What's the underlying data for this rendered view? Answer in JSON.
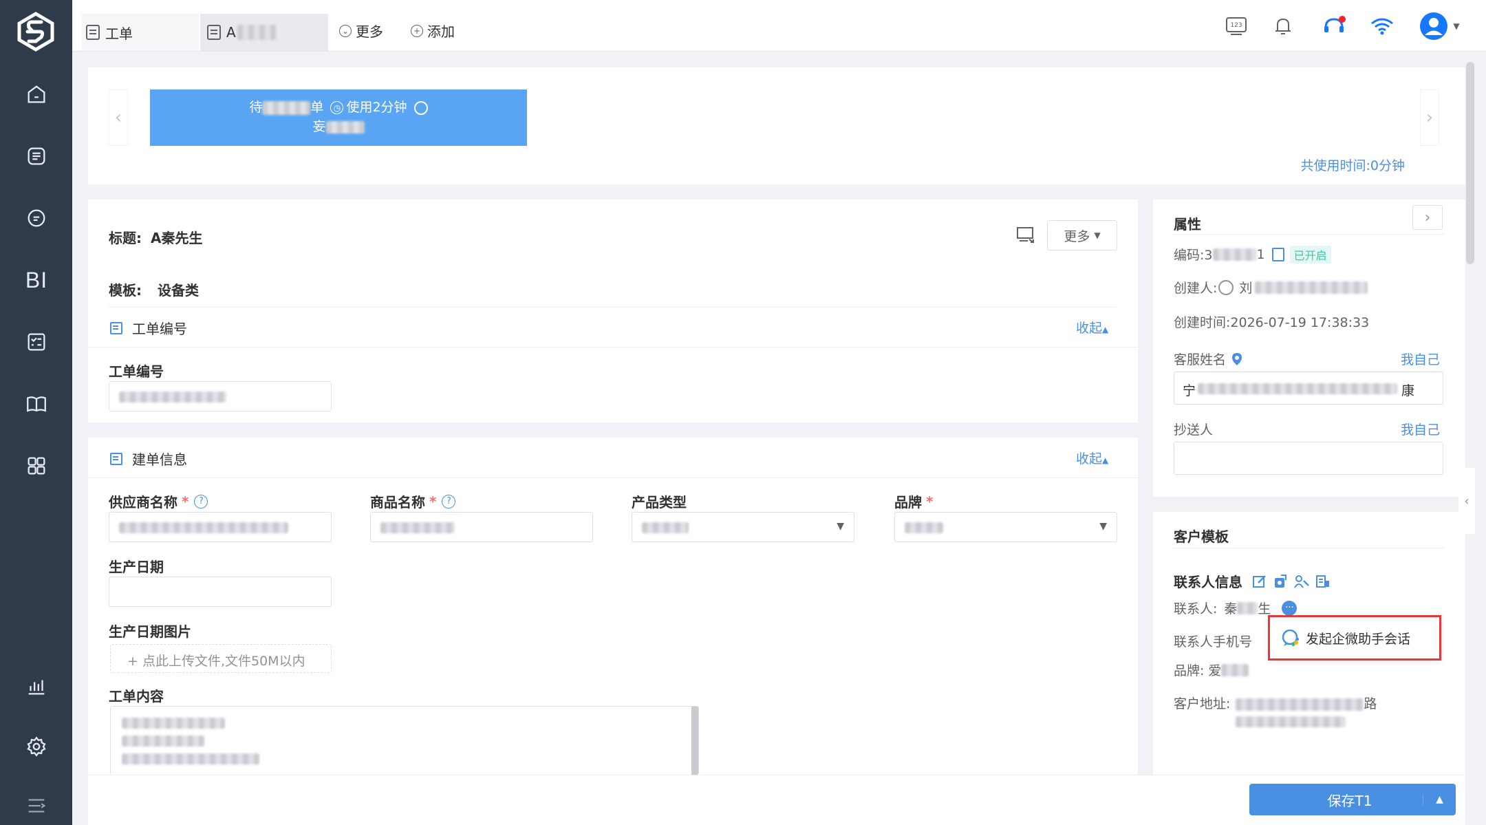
{
  "tabs": {
    "workorder": "工单",
    "second_prefix": "A",
    "more": "更多",
    "add": "添加"
  },
  "timer_card": {
    "prefix": "待",
    "mid": "单",
    "usage": "使用2分钟",
    "line2_prefix": "妄"
  },
  "total_time": "共使用时间:0分钟",
  "header": {
    "title_label": "标题:",
    "title_value": "A秦先生",
    "template_label": "模板:",
    "template_value": "设备类",
    "more_button": "更多"
  },
  "section_number": {
    "title": "工单编号",
    "collapse": "收起",
    "field_label": "工单编号"
  },
  "section_build": {
    "title": "建单信息",
    "collapse": "收起",
    "supplier_label": "供应商名称",
    "product_name_label": "商品名称",
    "product_type_label": "产品类型",
    "brand_label": "品牌",
    "production_date_label": "生产日期",
    "production_image_label": "生产日期图片",
    "upload_text": "+ 点此上传文件,文件50M以内",
    "content_label": "工单内容",
    "required_mark": "*",
    "help_mark": "?"
  },
  "attributes": {
    "title": "属性",
    "code_label": "编码:3",
    "code_suffix": "1",
    "status_badge": "已开启",
    "creator_label": "创建人:",
    "creator_prefix": "刘",
    "created_time": "创建时间:2026-07-19 17:38:33",
    "agent_label": "客服姓名",
    "agent_value_prefix": "宁",
    "agent_value_suffix": "康",
    "cc_label": "抄送人",
    "myself": "我自己"
  },
  "customer": {
    "title": "客户模板",
    "contact_info_label": "联系人信息",
    "contact_label": "联系人:",
    "contact_prefix": "秦",
    "contact_suffix": "生",
    "phone_label": "联系人手机号",
    "brand_label": "品牌:",
    "brand_prefix": "爱",
    "address_label": "客户地址:",
    "address_suffix": "路",
    "popup_text": "发起企微助手会话"
  },
  "save_button": "保存T1",
  "colors": {
    "sidebar": "#2f3a4a",
    "primary": "#4a90e2",
    "timer_card": "#5aa5f3",
    "highlight_border": "#e2393b",
    "badge": "#3fc5b2"
  }
}
